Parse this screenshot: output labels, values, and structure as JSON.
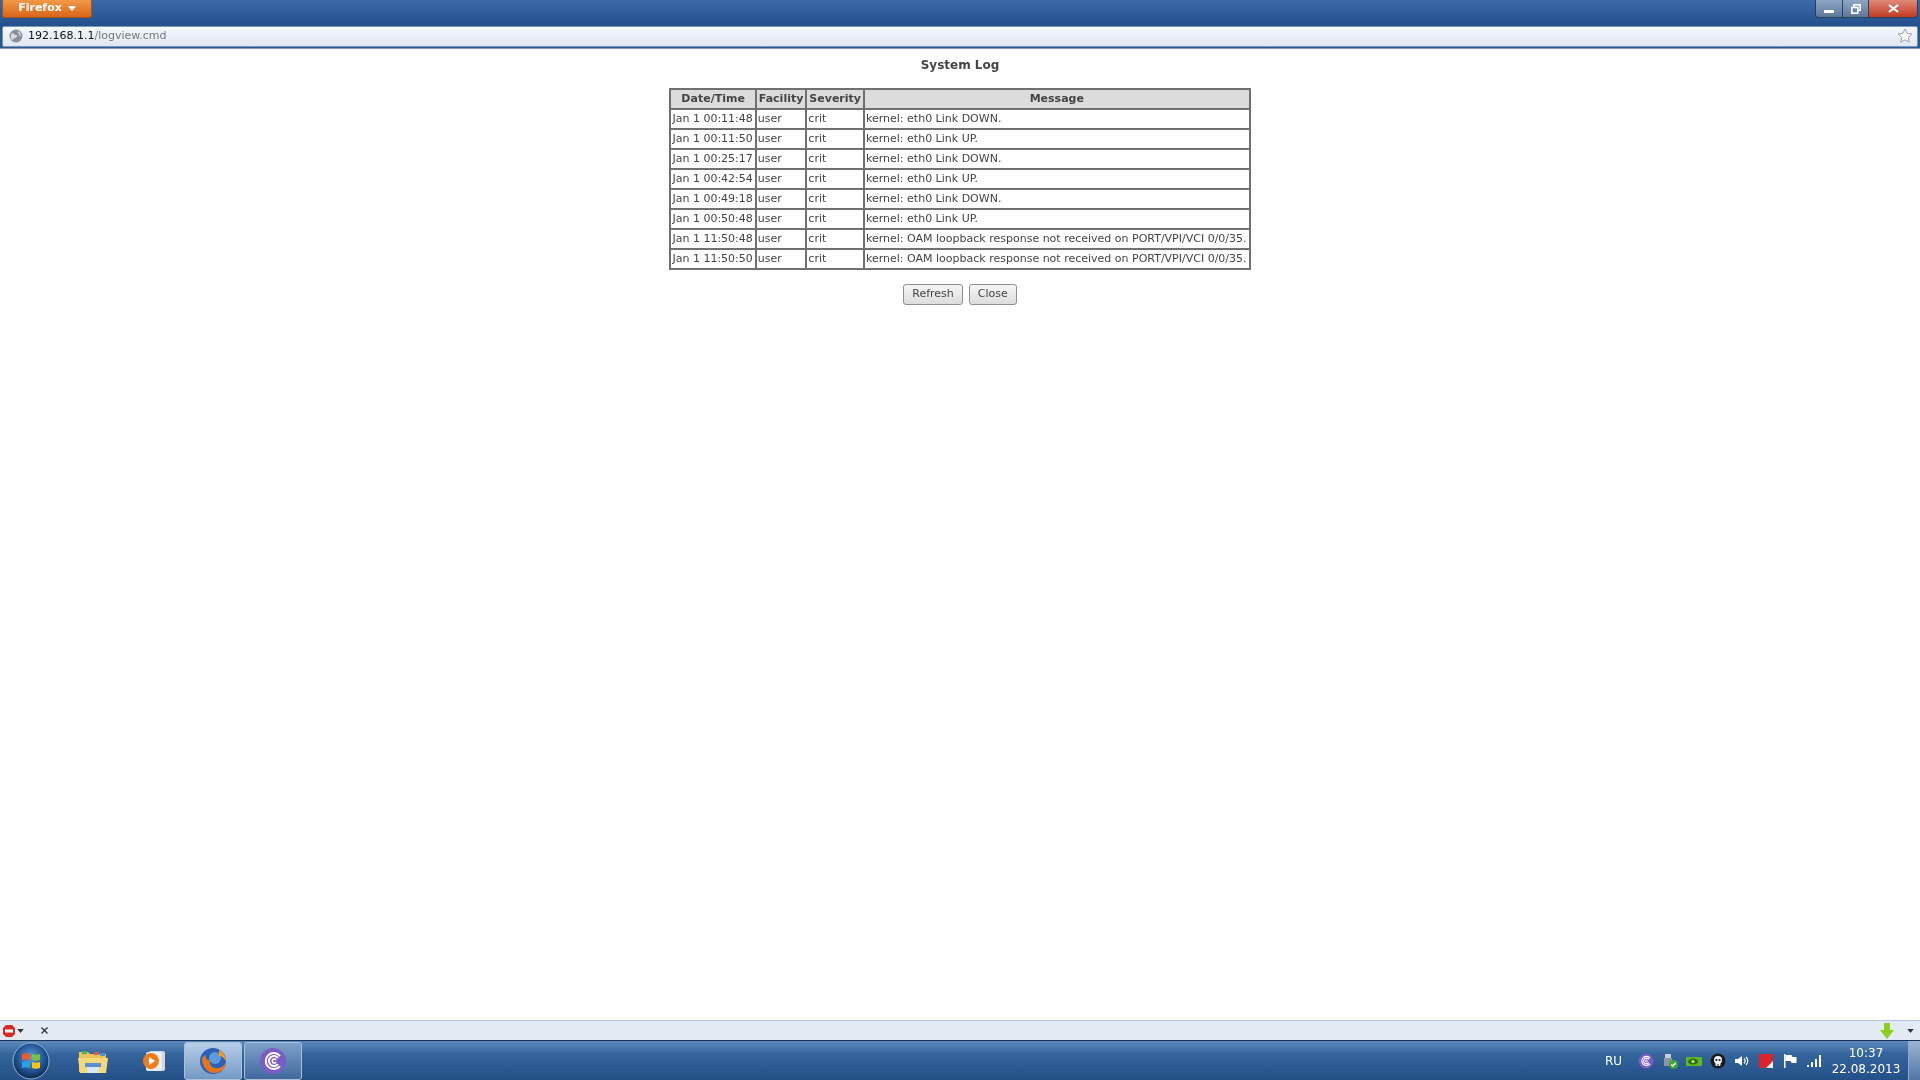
{
  "browser": {
    "menu_button": "Firefox",
    "address": {
      "host": "192.168.1.1",
      "path": "/logview.cmd"
    }
  },
  "page": {
    "title": "System Log",
    "table": {
      "columns": [
        "Date/Time",
        "Facility",
        "Severity",
        "Message"
      ],
      "rows": [
        {
          "date_time": "Jan 1 00:11:48",
          "facility": "user",
          "severity": "crit",
          "message": "kernel: eth0 Link DOWN."
        },
        {
          "date_time": "Jan 1 00:11:50",
          "facility": "user",
          "severity": "crit",
          "message": "kernel: eth0 Link UP."
        },
        {
          "date_time": "Jan 1 00:25:17",
          "facility": "user",
          "severity": "crit",
          "message": "kernel: eth0 Link DOWN."
        },
        {
          "date_time": "Jan 1 00:42:54",
          "facility": "user",
          "severity": "crit",
          "message": "kernel: eth0 Link UP."
        },
        {
          "date_time": "Jan 1 00:49:18",
          "facility": "user",
          "severity": "crit",
          "message": "kernel: eth0 Link DOWN."
        },
        {
          "date_time": "Jan 1 00:50:48",
          "facility": "user",
          "severity": "crit",
          "message": "kernel: eth0 Link UP."
        },
        {
          "date_time": "Jan 1 11:50:48",
          "facility": "user",
          "severity": "crit",
          "message": "kernel: OAM loopback response not received on PORT/VPI/VCI 0/0/35."
        },
        {
          "date_time": "Jan 1 11:50:50",
          "facility": "user",
          "severity": "crit",
          "message": "kernel: OAM loopback response not received on PORT/VPI/VCI 0/0/35."
        }
      ]
    },
    "buttons": [
      "Refresh",
      "Close"
    ]
  },
  "taskbar": {
    "apps": [
      {
        "kind": "folder",
        "running": false,
        "active": false
      },
      {
        "kind": "player",
        "running": false,
        "active": false
      },
      {
        "kind": "browser",
        "running": true,
        "active": true
      },
      {
        "kind": "torrent",
        "running": true,
        "active": false
      }
    ],
    "tray": {
      "language": "RU",
      "time": "10:37",
      "date": "22.08.2013"
    }
  }
}
